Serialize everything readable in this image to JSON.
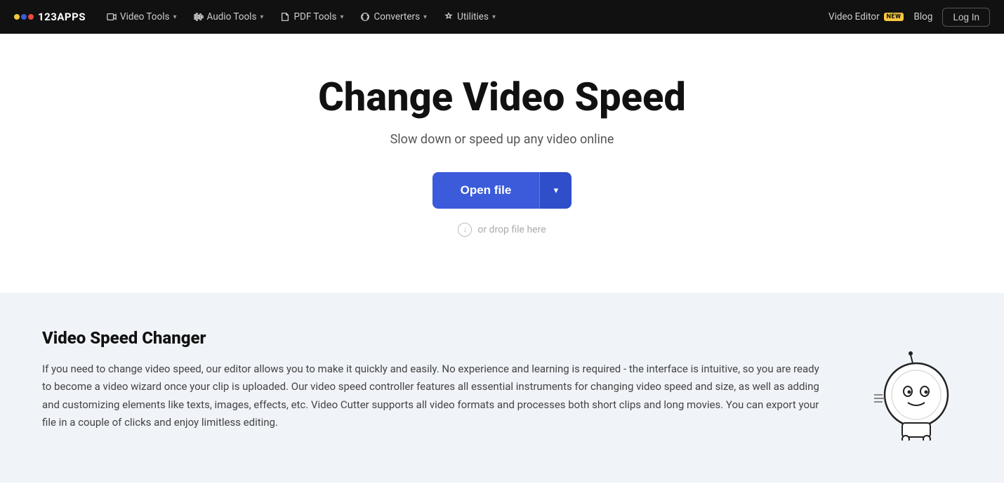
{
  "logo": {
    "text": "123APPS",
    "dots": [
      {
        "color": "#f5c842"
      },
      {
        "color": "#3b5bdb"
      },
      {
        "color": "#e74c3c"
      }
    ]
  },
  "nav": {
    "items": [
      {
        "label": "Video Tools",
        "icon": "video-icon"
      },
      {
        "label": "Audio Tools",
        "icon": "audio-icon"
      },
      {
        "label": "PDF Tools",
        "icon": "pdf-icon"
      },
      {
        "label": "Converters",
        "icon": "converters-icon"
      },
      {
        "label": "Utilities",
        "icon": "utilities-icon"
      }
    ],
    "right": {
      "video_editor_label": "Video Editor",
      "badge": "NEW",
      "blog_label": "Blog",
      "login_label": "Log In"
    }
  },
  "hero": {
    "title": "Change Video Speed",
    "subtitle": "Slow down or speed up any video online",
    "open_file_label": "Open file",
    "drop_hint": "or drop file here"
  },
  "info": {
    "title": "Video Speed Changer",
    "body": "If you need to change video speed, our editor allows you to make it quickly and easily. No experience and learning is required - the interface is intuitive, so you are ready to become a video wizard once your clip is uploaded. Our video speed controller features all essential instruments for changing video speed and size, as well as adding and customizing elements like texts, images, effects, etc. Video Cutter supports all video formats and processes both short clips and long movies. You can export your file in a couple of clicks and enjoy limitless editing."
  }
}
